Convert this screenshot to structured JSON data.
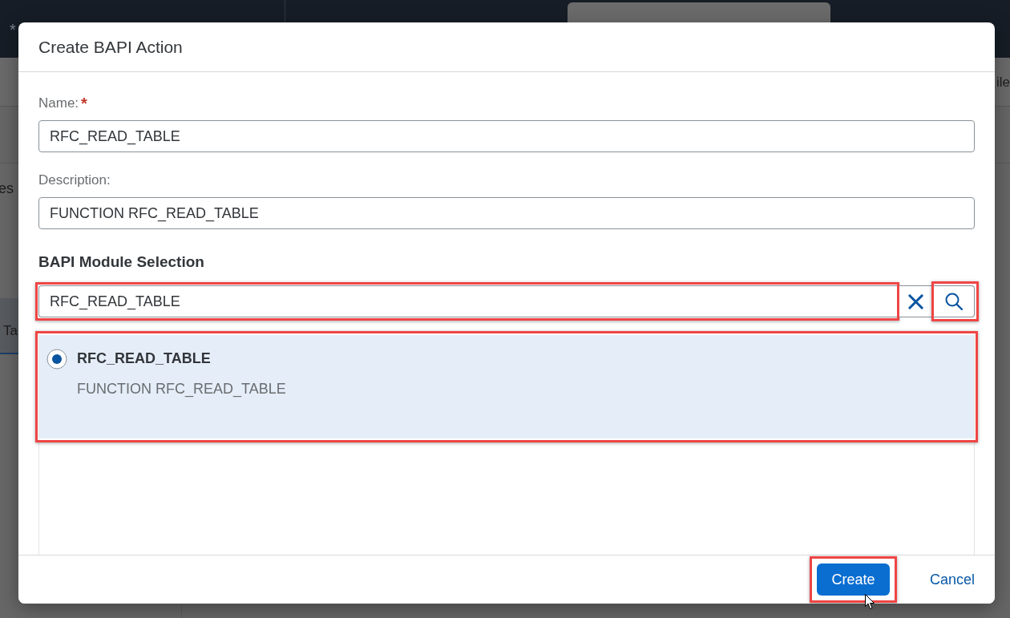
{
  "app": {
    "header": {
      "text_fragment": "*"
    },
    "toolbar": {
      "text_fragment": "ile"
    },
    "side_panel": {
      "text_fragment": "es",
      "tab": {
        "label": "Ta",
        "selected": true
      }
    }
  },
  "dialog": {
    "title": "Create BAPI Action",
    "fields": [
      {
        "label": "Name:",
        "required_mark": "*",
        "value": "RFC_READ_TABLE"
      },
      {
        "label": "Description:",
        "value": "FUNCTION RFC_READ_TABLE"
      }
    ],
    "module_selection": {
      "heading": "BAPI Module Selection",
      "search": {
        "value": "RFC_READ_TABLE",
        "highlighted": true
      },
      "search_button": {
        "highlighted": true
      },
      "results": [
        {
          "name": "RFC_READ_TABLE",
          "description": "FUNCTION RFC_READ_TABLE",
          "selected": true,
          "highlighted": true
        }
      ]
    },
    "buttons": [
      {
        "label": "Create",
        "kind": "primary",
        "highlighted": true
      },
      {
        "label": "Cancel",
        "kind": "transparent",
        "highlighted": false
      }
    ]
  }
}
